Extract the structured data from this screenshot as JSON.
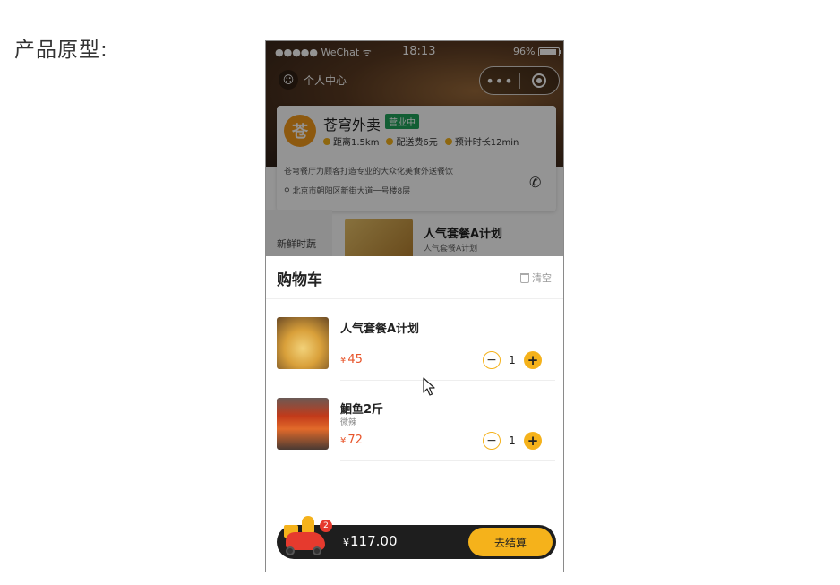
{
  "slide": {
    "title": "产品原型:"
  },
  "status_bar": {
    "signal": "●●●●● WeChat",
    "time": "18:13",
    "battery": "96%"
  },
  "nav": {
    "profile_label": "个人中心",
    "capsule_more": "•••"
  },
  "shop": {
    "logo_char": "苍",
    "name": "苍穹外卖",
    "status_badge": "营业中",
    "distance": "距离1.5km",
    "delivery_fee": "配送费6元",
    "eta": "预计时长12min",
    "description": "苍穹餐厅为顾客打造专业的大众化美食外送餐饮",
    "address": "北京市朝阳区新街大道一号楼8层"
  },
  "menu": {
    "category": "新鲜时蔬",
    "dish_name": "人气套餐A计划",
    "dish_sub": "人气套餐A计划"
  },
  "cart": {
    "title": "购物车",
    "clear_label": "清空",
    "items": [
      {
        "name": "人气套餐A计划",
        "spec": "",
        "currency": "¥",
        "price": "45",
        "quantity": "1"
      },
      {
        "name": "鮰鱼2斤",
        "spec": "微辣",
        "currency": "¥",
        "price": "72",
        "quantity": "1"
      }
    ]
  },
  "checkout": {
    "badge_count": "2",
    "currency": "¥",
    "total": "117.00",
    "button_label": "去结算"
  },
  "colors": {
    "accent": "#f5b21b",
    "price": "#e8552b",
    "badge_green": "#1fa35b",
    "bar": "#1e1e1e"
  },
  "icons": [
    "wifi-icon",
    "battery-icon",
    "user-icon",
    "more-icon",
    "target-icon",
    "clock-icon",
    "phone-icon",
    "location-icon",
    "trash-icon",
    "minus-icon",
    "plus-icon",
    "scooter-icon",
    "cursor-icon"
  ]
}
